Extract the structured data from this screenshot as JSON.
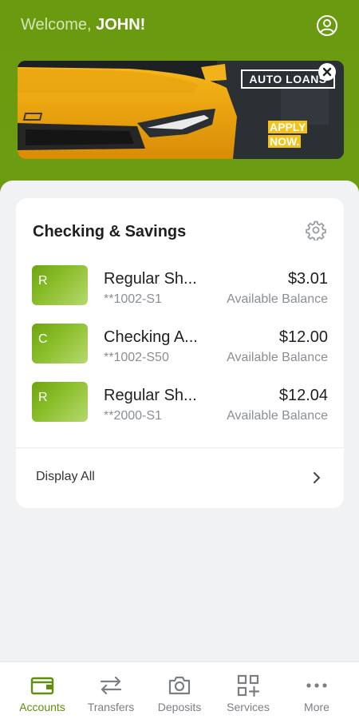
{
  "header": {
    "welcome_prefix": "Welcome, ",
    "user_name": "JOHN!",
    "profile_icon": "user-circle-icon"
  },
  "banner": {
    "title": "AUTO LOANS",
    "cta_line1": "APPLY",
    "cta_line2": "NOW.",
    "close_icon": "close-icon"
  },
  "accounts_card": {
    "title": "Checking & Savings",
    "settings_icon": "gear-icon",
    "accounts": [
      {
        "initial": "R",
        "name": "Regular Sh...",
        "number": "**1002-S1",
        "amount": "$3.01",
        "balance_label": "Available Balance"
      },
      {
        "initial": "C",
        "name": "Checking A...",
        "number": "**1002-S50",
        "amount": "$12.00",
        "balance_label": "Available Balance"
      },
      {
        "initial": "R",
        "name": "Regular Sh...",
        "number": "**2000-S1",
        "amount": "$12.04",
        "balance_label": "Available Balance"
      }
    ],
    "display_all_label": "Display All"
  },
  "nav": {
    "items": [
      {
        "label": "Accounts",
        "icon": "wallet-icon",
        "active": true
      },
      {
        "label": "Transfers",
        "icon": "transfer-arrows-icon",
        "active": false
      },
      {
        "label": "Deposits",
        "icon": "camera-icon",
        "active": false
      },
      {
        "label": "Services",
        "icon": "grid-plus-icon",
        "active": false
      },
      {
        "label": "More",
        "icon": "more-dots-icon",
        "active": false
      }
    ]
  },
  "colors": {
    "brand_green": "#6a9a0f",
    "accent_yellow": "#f3c31b"
  }
}
